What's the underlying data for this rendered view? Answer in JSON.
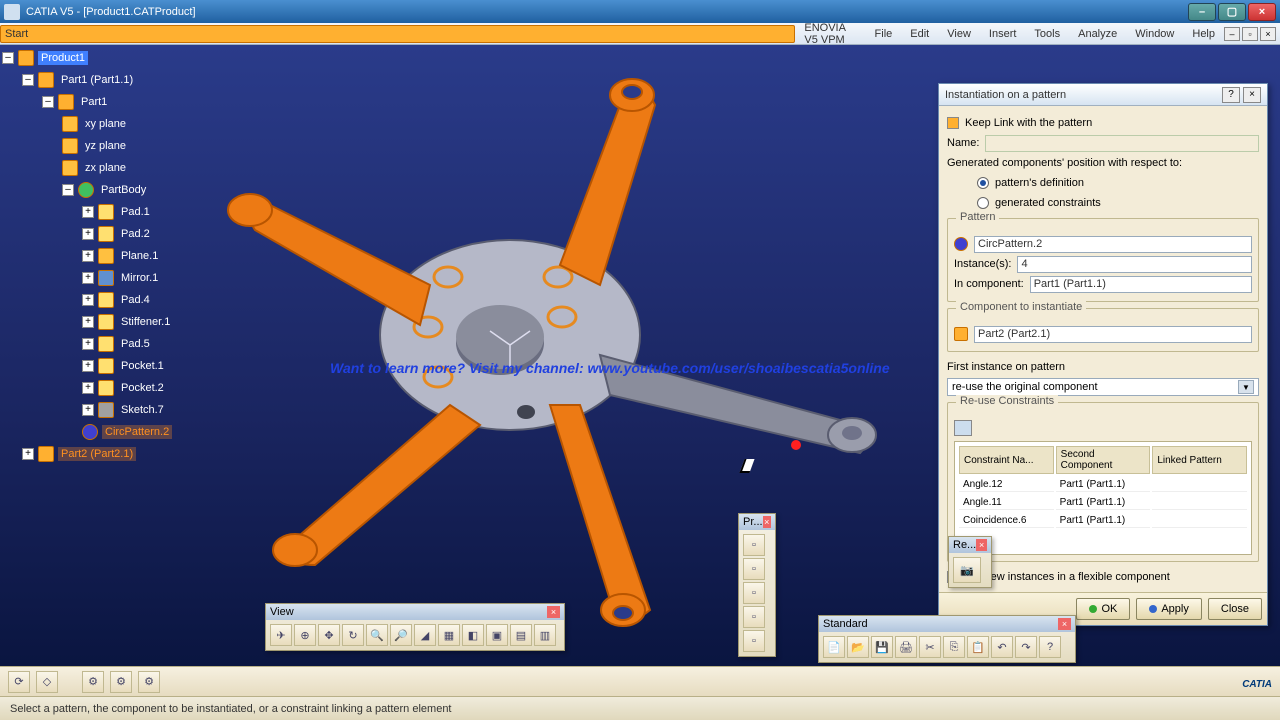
{
  "window": {
    "title": "CATIA V5 - [Product1.CATProduct]"
  },
  "menu": [
    "Start",
    "ENOVIA V5 VPM",
    "File",
    "Edit",
    "View",
    "Insert",
    "Tools",
    "Analyze",
    "Window",
    "Help"
  ],
  "tree": {
    "root": "Product1",
    "n1": "Part1 (Part1.1)",
    "n2": "Part1",
    "planes": [
      "xy plane",
      "yz plane",
      "zx plane"
    ],
    "body": "PartBody",
    "feat": [
      "Pad.1",
      "Pad.2",
      "Plane.1",
      "Mirror.1",
      "Pad.4",
      "Stiffener.1",
      "Pad.5",
      "Pocket.1",
      "Pocket.2",
      "Sketch.7"
    ],
    "patt": "CircPattern.2",
    "n3": "Part2 (Part2.1)"
  },
  "overlay": "Want to learn more? Visit my channel: www.youtube.com/user/shoaibescatia5online",
  "dialog": {
    "title": "Instantiation on a pattern",
    "keeplink": "Keep Link with the pattern",
    "name": "Name:",
    "gen": "Generated components' position with respect to:",
    "r1": "pattern's definition",
    "r2": "generated constraints",
    "g_pattern": "Pattern",
    "pattern_v": "CircPattern.2",
    "inst": "Instance(s):",
    "inst_v": "4",
    "incomp": "In component:",
    "incomp_v": "Part1 (Part1.1)",
    "g_comp": "Component to instantiate",
    "comp_v": "Part2 (Part2.1)",
    "first": "First instance on pattern",
    "first_v": "re-use the original component",
    "g_reuse": "Re-use Constraints",
    "cols": [
      "Constraint Na...",
      "Second Component",
      "Linked Pattern"
    ],
    "rows": [
      [
        "Angle.12",
        "Part1 (Part1.1)",
        ""
      ],
      [
        "Angle.11",
        "Part1 (Part1.1)",
        ""
      ],
      [
        "Coincidence.6",
        "Part1 (Part1.1)",
        ""
      ]
    ],
    "flex": "Put new instances in a flexible component",
    "ok": "OK",
    "apply": "Apply",
    "close": "Close"
  },
  "toolbars": {
    "view": "View",
    "pr": "Pr...",
    "re": "Re...",
    "std": "Standard"
  },
  "status": "Select a pattern, the component to be instantiated, or a constraint linking a pattern element",
  "logo": "CATIA"
}
